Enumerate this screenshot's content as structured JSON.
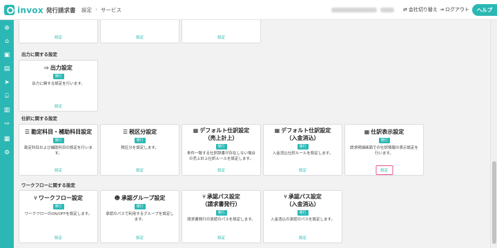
{
  "header": {
    "logo_text": "invox",
    "logo_sub": "発行請求書",
    "breadcrumb": [
      "設定",
      "サービス"
    ],
    "switch_company": "会社切り替え",
    "logout": "ログアウト",
    "help": "ヘルプ"
  },
  "sidebar": {
    "icons": [
      "plus-icon",
      "home-icon",
      "inbox-icon",
      "document-icon",
      "send-icon",
      "bank-icon",
      "building-icon",
      "export-icon",
      "chart-icon",
      "gear-icon"
    ]
  },
  "top_row": {
    "links": [
      "設定",
      "設定",
      "設定"
    ]
  },
  "sections": {
    "output": {
      "title": "出力に関する設定",
      "cards": [
        {
          "icon": "export-icon",
          "title": "出力設定",
          "badge": "発行",
          "desc": "出力に関する設定を行います。",
          "link": "設定"
        }
      ]
    },
    "journal": {
      "title": "仕訳に関する設定",
      "cards": [
        {
          "icon": "list-icon",
          "title": "勘定科目・補助科目設定",
          "badge": "発行",
          "desc": "勘定科目および補助科目の設定を行います。",
          "link": "設定"
        },
        {
          "icon": "list-icon",
          "title": "税区分設定",
          "badge": "発行",
          "desc": "税区分を設定します。",
          "link": "設定"
        },
        {
          "icon": "table-icon",
          "title": "デフォルト仕訳設定",
          "title2": "（売上計上）",
          "badge": "発行",
          "desc": "条件一致する仕訳辞書が存在しない場合の売上計上仕訳ルールを設定します。",
          "link": "設定"
        },
        {
          "icon": "table-icon",
          "title": "デフォルト仕訳設定",
          "title2": "（入金消込）",
          "badge": "発行",
          "desc": "入金消込仕訳ルールを設定します。",
          "link": "設定"
        },
        {
          "icon": "table-icon",
          "title": "仕訳表示設定",
          "badge": "発行",
          "desc": "請求明細画面での仕訳情報の表示設定を行います。",
          "link": "設定"
        }
      ]
    },
    "workflow": {
      "title": "ワークフローに関する設定",
      "cards": [
        {
          "icon": "workflow-icon",
          "title": "ワークフロー設定",
          "badge": "発行",
          "desc": "ワークフローのON/OFFを設定します。",
          "link": "設定"
        },
        {
          "icon": "users-icon",
          "title": "承認グループ設定",
          "badge": "発行",
          "desc": "承認のパスで利用するグループを設定します。",
          "link": "設定"
        },
        {
          "icon": "route-icon",
          "title": "承認パス設定",
          "title2": "（請求書発行）",
          "badge": "発行",
          "desc": "請求書発行の承認のパスを設定します。",
          "link": "設定"
        },
        {
          "icon": "route-icon",
          "title": "承認パス設定",
          "title2": "（入金消込）",
          "badge": "発行",
          "desc": "入金消込の承認のパスを設定します。",
          "link": "設定"
        }
      ]
    }
  }
}
